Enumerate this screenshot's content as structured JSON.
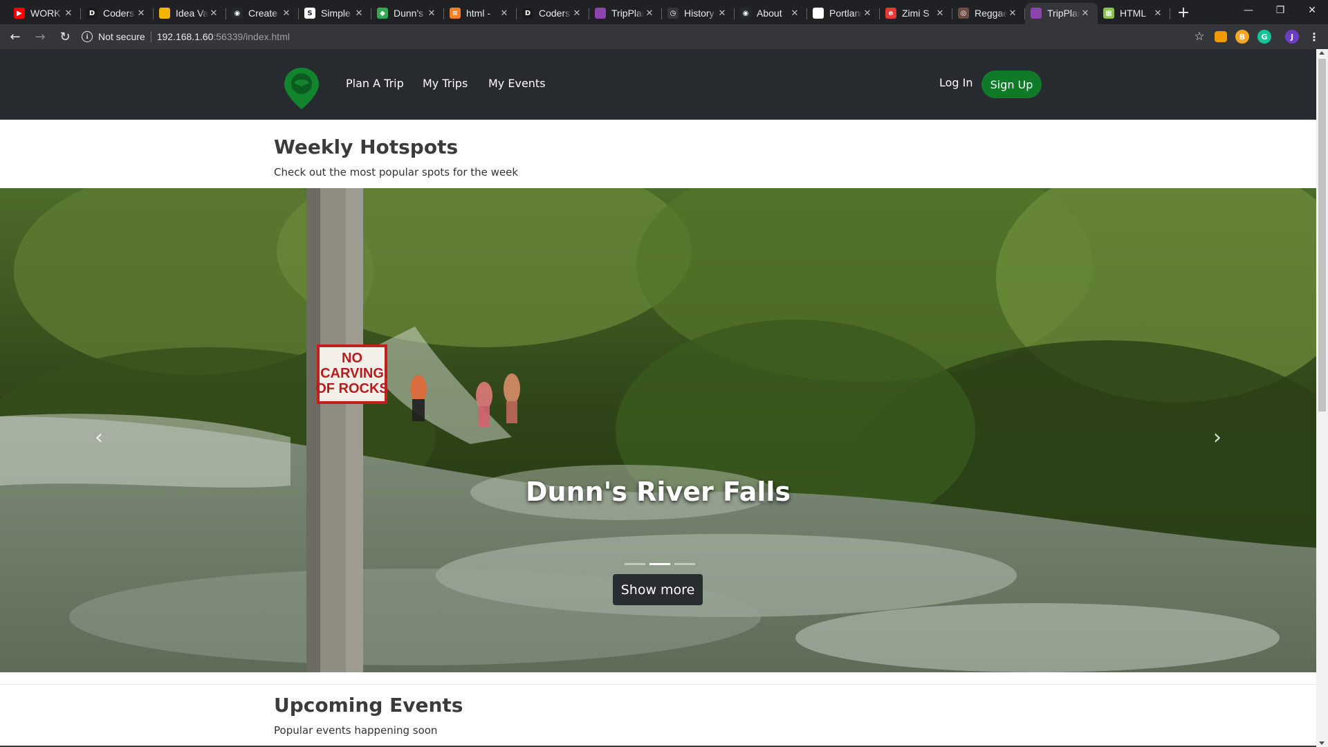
{
  "browser": {
    "tabs": [
      {
        "title": "WORK",
        "icon": "youtube-icon",
        "color": "#ff0000",
        "glyph": "▶"
      },
      {
        "title": "Coders",
        "icon": "dev-icon",
        "color": "#1a1a1a",
        "glyph": "D"
      },
      {
        "title": "Idea Vault",
        "icon": "slides-icon",
        "color": "#f4b400",
        "glyph": ""
      },
      {
        "title": "Create",
        "icon": "github-icon",
        "color": "#24292e",
        "glyph": "◉"
      },
      {
        "title": "Simple",
        "icon": "site-icon",
        "color": "#ffffff",
        "glyph": "S"
      },
      {
        "title": "Dunn's",
        "icon": "maps-icon",
        "color": "#34a853",
        "glyph": "◆"
      },
      {
        "title": "html -",
        "icon": "stackoverflow-icon",
        "color": "#f48024",
        "glyph": "≡"
      },
      {
        "title": "Coders",
        "icon": "dev-icon",
        "color": "#1a1a1a",
        "glyph": "D"
      },
      {
        "title": "TripPlanner",
        "icon": "tripplanner-icon",
        "color": "#8e44ad",
        "glyph": ""
      },
      {
        "title": "History",
        "icon": "history-icon",
        "color": "#35363a",
        "glyph": "◷"
      },
      {
        "title": "About",
        "icon": "github-icon",
        "color": "#24292e",
        "glyph": "◉"
      },
      {
        "title": "Portland",
        "icon": "doc-icon",
        "color": "#ffffff",
        "glyph": ""
      },
      {
        "title": "Zimi S",
        "icon": "e-icon",
        "color": "#e53935",
        "glyph": "e"
      },
      {
        "title": "Reggae",
        "icon": "reggae-icon",
        "color": "#6d4c41",
        "glyph": "◎"
      },
      {
        "title": "TripPlanner",
        "icon": "tripplanner-icon",
        "color": "#8e44ad",
        "glyph": "",
        "active": true
      },
      {
        "title": "HTML",
        "icon": "sheet-icon",
        "color": "#8bc34a",
        "glyph": "▦"
      }
    ],
    "security_label": "Not secure",
    "url_host": "192.168.1.60",
    "url_rest": ":56339/index.html"
  },
  "site": {
    "brand_color": "#0f7a28",
    "nav": {
      "plan": "Plan A Trip",
      "trips": "My Trips",
      "events": "My Events",
      "login": "Log In",
      "signup": "Sign Up"
    },
    "hotspots": {
      "title": "Weekly Hotspots",
      "subtitle": "Check out the most popular spots for the week"
    },
    "carousel": {
      "caption": "Dunn's River Falls",
      "button": "Show more",
      "sign_lines": [
        "NO",
        "CARVING",
        "OF ROCKS"
      ],
      "active_index": 1,
      "count": 3
    },
    "events": {
      "title": "Upcoming Events",
      "subtitle": "Popular events happening soon"
    }
  }
}
